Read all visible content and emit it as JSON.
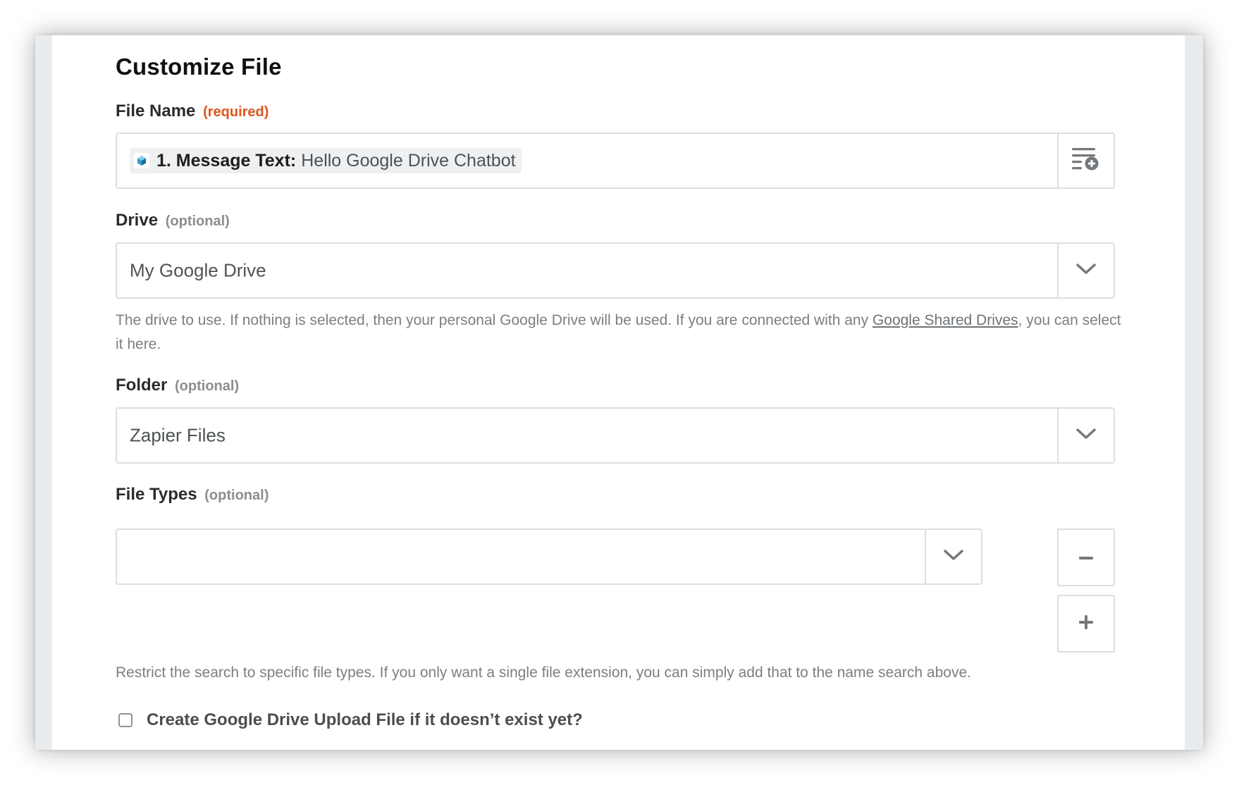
{
  "section": {
    "title": "Customize File"
  },
  "fields": {
    "file_name": {
      "label": "File Name",
      "qualifier": "(required)",
      "pill": {
        "key": "1. Message Text:",
        "value": "Hello Google Drive Chatbot"
      }
    },
    "drive": {
      "label": "Drive",
      "qualifier": "(optional)",
      "value": "My Google Drive",
      "help_before": "The drive to use. If nothing is selected, then your personal Google Drive will be used. If you are connected with any ",
      "help_link": "Google Shared Drives",
      "help_after": ", you can select it here."
    },
    "folder": {
      "label": "Folder",
      "qualifier": "(optional)",
      "value": "Zapier Files"
    },
    "file_types": {
      "label": "File Types",
      "qualifier": "(optional)",
      "value": "",
      "help": "Restrict the search to specific file types. If you only want a single file extension, you can simply add that to the name search above."
    }
  },
  "create_checkbox": {
    "label": "Create Google Drive Upload File if it doesn’t exist yet?",
    "checked": false
  },
  "icons": {
    "insert_data": "list-plus-icon",
    "dropdown": "chevron-down-icon",
    "remove": "minus-icon",
    "add": "plus-icon",
    "app": "app-cube-icon"
  },
  "colors": {
    "required": "#e0541b",
    "optional": "#8a8e91",
    "border": "#dcdfe1",
    "pill_bg": "#eef0f1",
    "app_icon": "#2f9fcf"
  }
}
